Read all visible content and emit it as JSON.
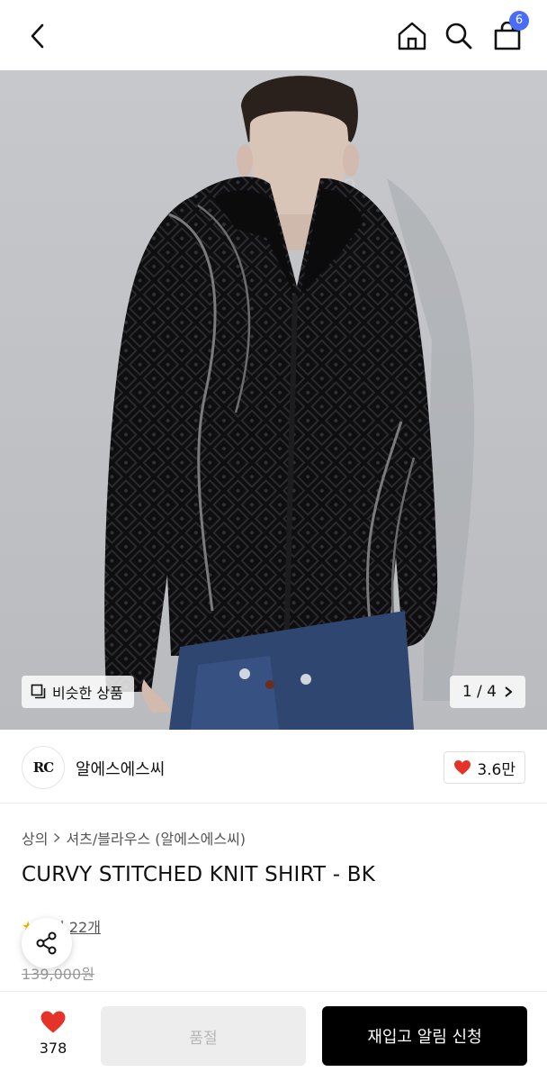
{
  "header": {
    "cart_count": "6"
  },
  "gallery": {
    "similar_label": "비슷한 상품",
    "pager_text": "1 / 4"
  },
  "brand": {
    "logo_text": "RC",
    "name": "알에스에스씨",
    "likes": "3.6만"
  },
  "product": {
    "breadcrumb": [
      "상의",
      "셔츠/블라우스 (알에스에스씨)"
    ],
    "title": "CURVY STITCHED KNIT SHIRT - BK",
    "review_text": "후기 22개",
    "price": "139,000원"
  },
  "bottom": {
    "wish_count": "378",
    "soldout_label": "품절",
    "notify_label": "재입고 알림 신청"
  },
  "colors": {
    "accent": "#4a6cf7",
    "heart": "#e5332a",
    "cta": "#000000"
  }
}
